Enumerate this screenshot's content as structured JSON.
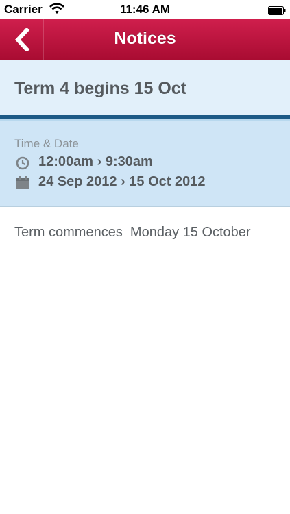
{
  "status_bar": {
    "carrier": "Carrier",
    "time": "11:46 AM",
    "wifi_icon": "wifi-icon",
    "battery_icon": "battery-icon"
  },
  "navbar": {
    "title": "Notices",
    "back_icon": "chevron-left-icon",
    "color": "#c01a43"
  },
  "notice": {
    "title": "Term 4 begins 15 Oct",
    "time_date_label": "Time & Date",
    "time_range": "12:00am › 9:30am",
    "date_range": "24 Sep 2012 › 15 Oct 2012",
    "time_icon": "clock-icon",
    "date_icon": "calendar-icon",
    "body": "Term commences  Monday 15 October"
  }
}
